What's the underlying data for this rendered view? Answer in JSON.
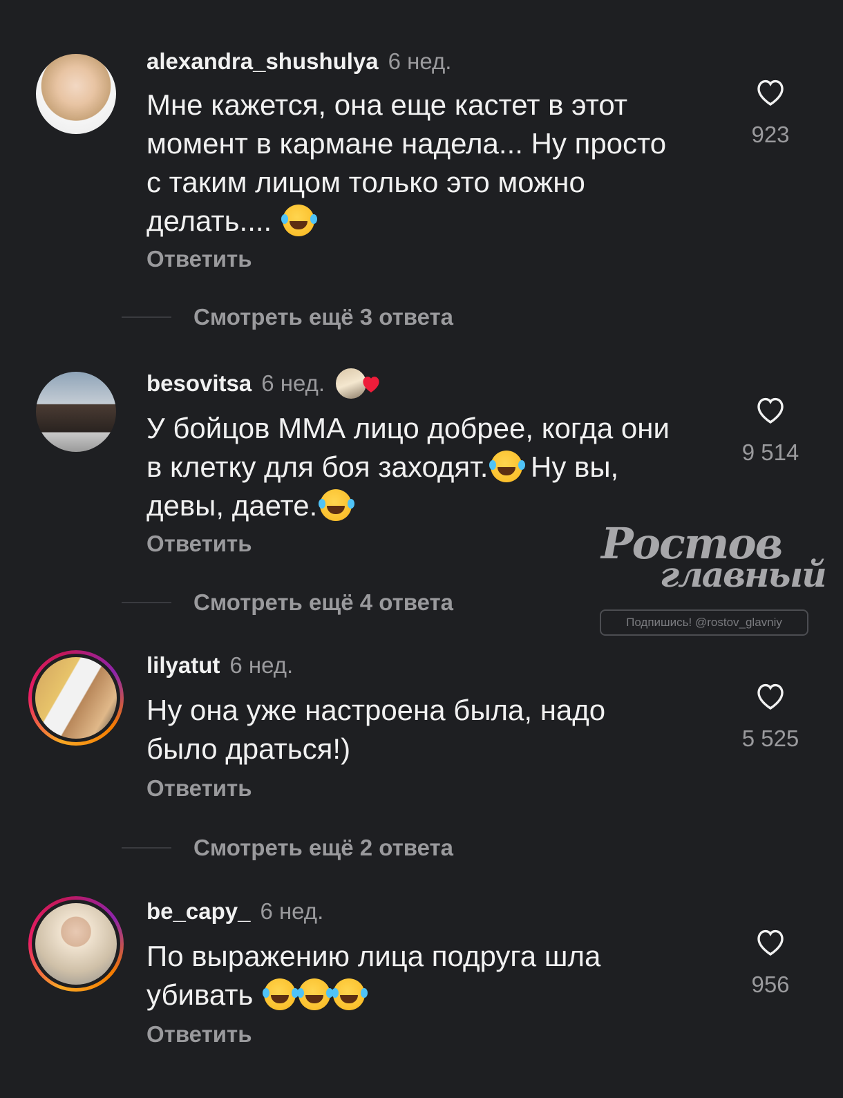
{
  "comments": [
    {
      "username": "alexandra_shushulya",
      "time": "6 нед.",
      "text_lines": [
        "Мне кажется, она еще кастет в этот",
        "момент в кармане надела... Ну просто",
        "с таким лицом только это можно",
        "делать...."
      ],
      "emojis": [
        "face-with-tears-of-joy"
      ],
      "reply_label": "Ответить",
      "likes": "923",
      "more_replies": "Смотреть ещё 3 ответа"
    },
    {
      "username": "besovitsa",
      "time": "6 нед.",
      "text_lines": [
        "У бойцов ММА лицо добрее, когда они",
        "в клетку для боя заходят.",
        " Ну вы,",
        "девы, даете."
      ],
      "emojis": [
        "face-with-tears-of-joy",
        "face-with-tears-of-joy"
      ],
      "reply_label": "Ответить",
      "likes": "9 514",
      "more_replies": "Смотреть ещё 4 ответа",
      "creator_reaction": "heart-icon"
    },
    {
      "username": "lilyatut",
      "time": "6 нед.",
      "text_lines": [
        "Ну она уже настроена была, надо",
        "было драться!)"
      ],
      "reply_label": "Ответить",
      "likes": "5 525",
      "more_replies": "Смотреть ещё 2 ответа"
    },
    {
      "username": "be_capy_",
      "time": "6 нед.",
      "text_lines": [
        "По выражению лица подруга шла",
        "убивать"
      ],
      "emojis": [
        "rolling-on-floor-laughing",
        "rolling-on-floor-laughing",
        "rolling-on-floor-laughing"
      ],
      "reply_label": "Ответить",
      "likes": "956"
    }
  ],
  "watermark": {
    "line1": "Ростов",
    "line2": "главный",
    "sub": "Подпишись! @rostov_glavniy"
  },
  "colors": {
    "background": "#1e1f22",
    "primary_text": "#f1f1f1",
    "secondary_text": "#9a9a9d"
  }
}
